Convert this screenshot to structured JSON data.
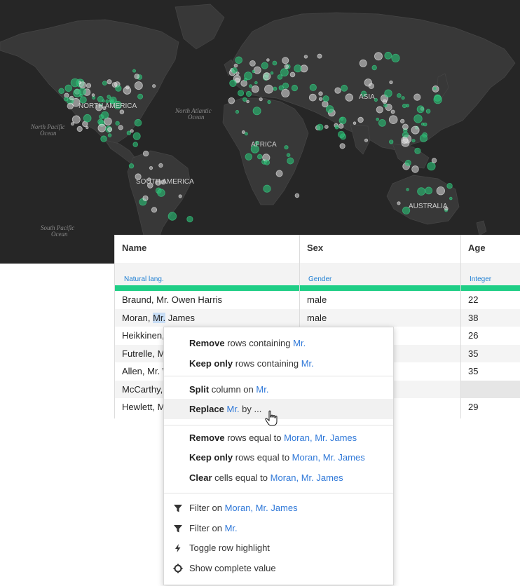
{
  "map": {
    "continent_labels": [
      "NORTH AMERICA",
      "SOUTH AMERICA",
      "AFRICA",
      "ASIA",
      "AUSTRALIA"
    ],
    "ocean_labels": {
      "north_pacific": [
        "North Pacific",
        "Ocean"
      ],
      "north_atlantic": [
        "North Atlantic",
        "Ocean"
      ],
      "south_pacific": [
        "South Pacific",
        "Ocean"
      ]
    },
    "colors": {
      "background": "#262626",
      "land": "#383838",
      "point_green": "#2ab872",
      "point_white": "#dcdcdc"
    }
  },
  "table": {
    "columns": [
      {
        "name": "Name",
        "type": "Natural lang."
      },
      {
        "name": "Sex",
        "type": "Gender"
      },
      {
        "name": "Age",
        "type": "Integer"
      }
    ],
    "rows": [
      {
        "name": "Braund, Mr. Owen Harris",
        "sex": "male",
        "age": "22"
      },
      {
        "name_pre": "Moran, ",
        "name_sel": "Mr.",
        "name_post": " James",
        "sex": "male",
        "age": "38"
      },
      {
        "name": "Heikkinen,",
        "sex": "",
        "age": "26"
      },
      {
        "name": "Futrelle, M",
        "sex": "",
        "age": "35"
      },
      {
        "name": "Allen, Mr. W",
        "sex": "",
        "age": "35"
      },
      {
        "name": "McCarthy,",
        "sex": "",
        "age": ""
      },
      {
        "name": "Hewlett, M",
        "sex": "",
        "age": "29"
      }
    ],
    "accent_color": "#1fce86"
  },
  "menu": {
    "remove_rows_containing": {
      "bold": "Remove",
      "text": " rows containing ",
      "value": "Mr."
    },
    "keep_rows_containing": {
      "bold": "Keep only",
      "text": " rows containing ",
      "value": "Mr."
    },
    "split_column": {
      "bold": "Split",
      "text": " column on ",
      "value": "Mr."
    },
    "replace": {
      "bold": "Replace",
      "text_pre": " ",
      "value": "Mr.",
      "text_post": " by ..."
    },
    "remove_rows_equal": {
      "bold": "Remove",
      "text": " rows equal to ",
      "value": "Moran, Mr. James"
    },
    "keep_rows_equal": {
      "bold": "Keep only",
      "text": " rows equal to ",
      "value": "Moran, Mr. James"
    },
    "clear_cells_equal": {
      "bold": "Clear",
      "text": " cells equal to ",
      "value": "Moran, Mr. James"
    },
    "filter_on_value": {
      "text": "Filter on ",
      "value": "Moran, Mr. James",
      "icon": "filter-icon"
    },
    "filter_on_selection": {
      "text": "Filter on ",
      "value": "Mr.",
      "icon": "filter-icon"
    },
    "toggle_highlight": {
      "text": "Toggle row highlight",
      "icon": "lightning-icon"
    },
    "show_complete": {
      "text": "Show complete value",
      "icon": "gear-icon"
    },
    "highlight_color": "#2f78d8"
  }
}
